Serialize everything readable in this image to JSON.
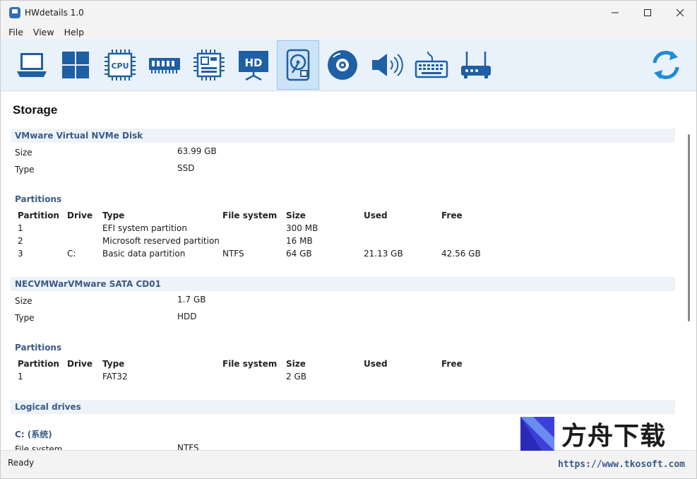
{
  "window": {
    "title": "HWdetails 1.0"
  },
  "menu": [
    "File",
    "View",
    "Help"
  ],
  "toolbar": {
    "tools": [
      {
        "name": "laptop-icon"
      },
      {
        "name": "windows-icon"
      },
      {
        "name": "cpu-icon",
        "text": "CPU"
      },
      {
        "name": "memory-icon"
      },
      {
        "name": "motherboard-icon"
      },
      {
        "name": "display-icon",
        "text": "HD"
      },
      {
        "name": "storage-icon"
      },
      {
        "name": "optical-disc-icon"
      },
      {
        "name": "speaker-icon"
      },
      {
        "name": "keyboard-icon"
      },
      {
        "name": "router-icon"
      },
      {
        "name": "refresh-icon"
      }
    ],
    "active_index": 6
  },
  "page": {
    "title": "Storage",
    "disk1": {
      "name": "VMware Virtual NVMe Disk",
      "size_label": "Size",
      "size": "63.99 GB",
      "type_label": "Type",
      "type": "SSD",
      "partitions_label": "Partitions",
      "columns": [
        "Partition",
        "Drive",
        "Type",
        "File system",
        "Size",
        "Used",
        "Free"
      ],
      "rows": [
        [
          "1",
          "",
          "EFI system partition",
          "",
          "300 MB",
          "",
          ""
        ],
        [
          "2",
          "",
          "Microsoft reserved partition",
          "",
          "16 MB",
          "",
          ""
        ],
        [
          "3",
          "C:",
          "Basic data partition",
          "NTFS",
          "64 GB",
          "21.13 GB",
          "42.56 GB"
        ]
      ]
    },
    "disk2": {
      "name": "NECVMWarVMware SATA CD01",
      "size_label": "Size",
      "size": "1.7 GB",
      "type_label": "Type",
      "type": "HDD",
      "partitions_label": "Partitions",
      "columns": [
        "Partition",
        "Drive",
        "Type",
        "File system",
        "Size",
        "Used",
        "Free"
      ],
      "rows": [
        [
          "1",
          "",
          "FAT32",
          "",
          "2 GB",
          "",
          ""
        ]
      ]
    },
    "logical": {
      "header": "Logical drives",
      "drive_name": "C: (系统)",
      "partial_label": "File system",
      "partial_value": "NTFS"
    }
  },
  "status": {
    "text": "Ready",
    "url": "https://www.tkosoft.com"
  },
  "watermark": {
    "text": "方舟下载"
  },
  "colors": {
    "accent": "#2f6fb5",
    "section": "#3b5a86",
    "toolbar_bg": "#e9f2fb"
  }
}
